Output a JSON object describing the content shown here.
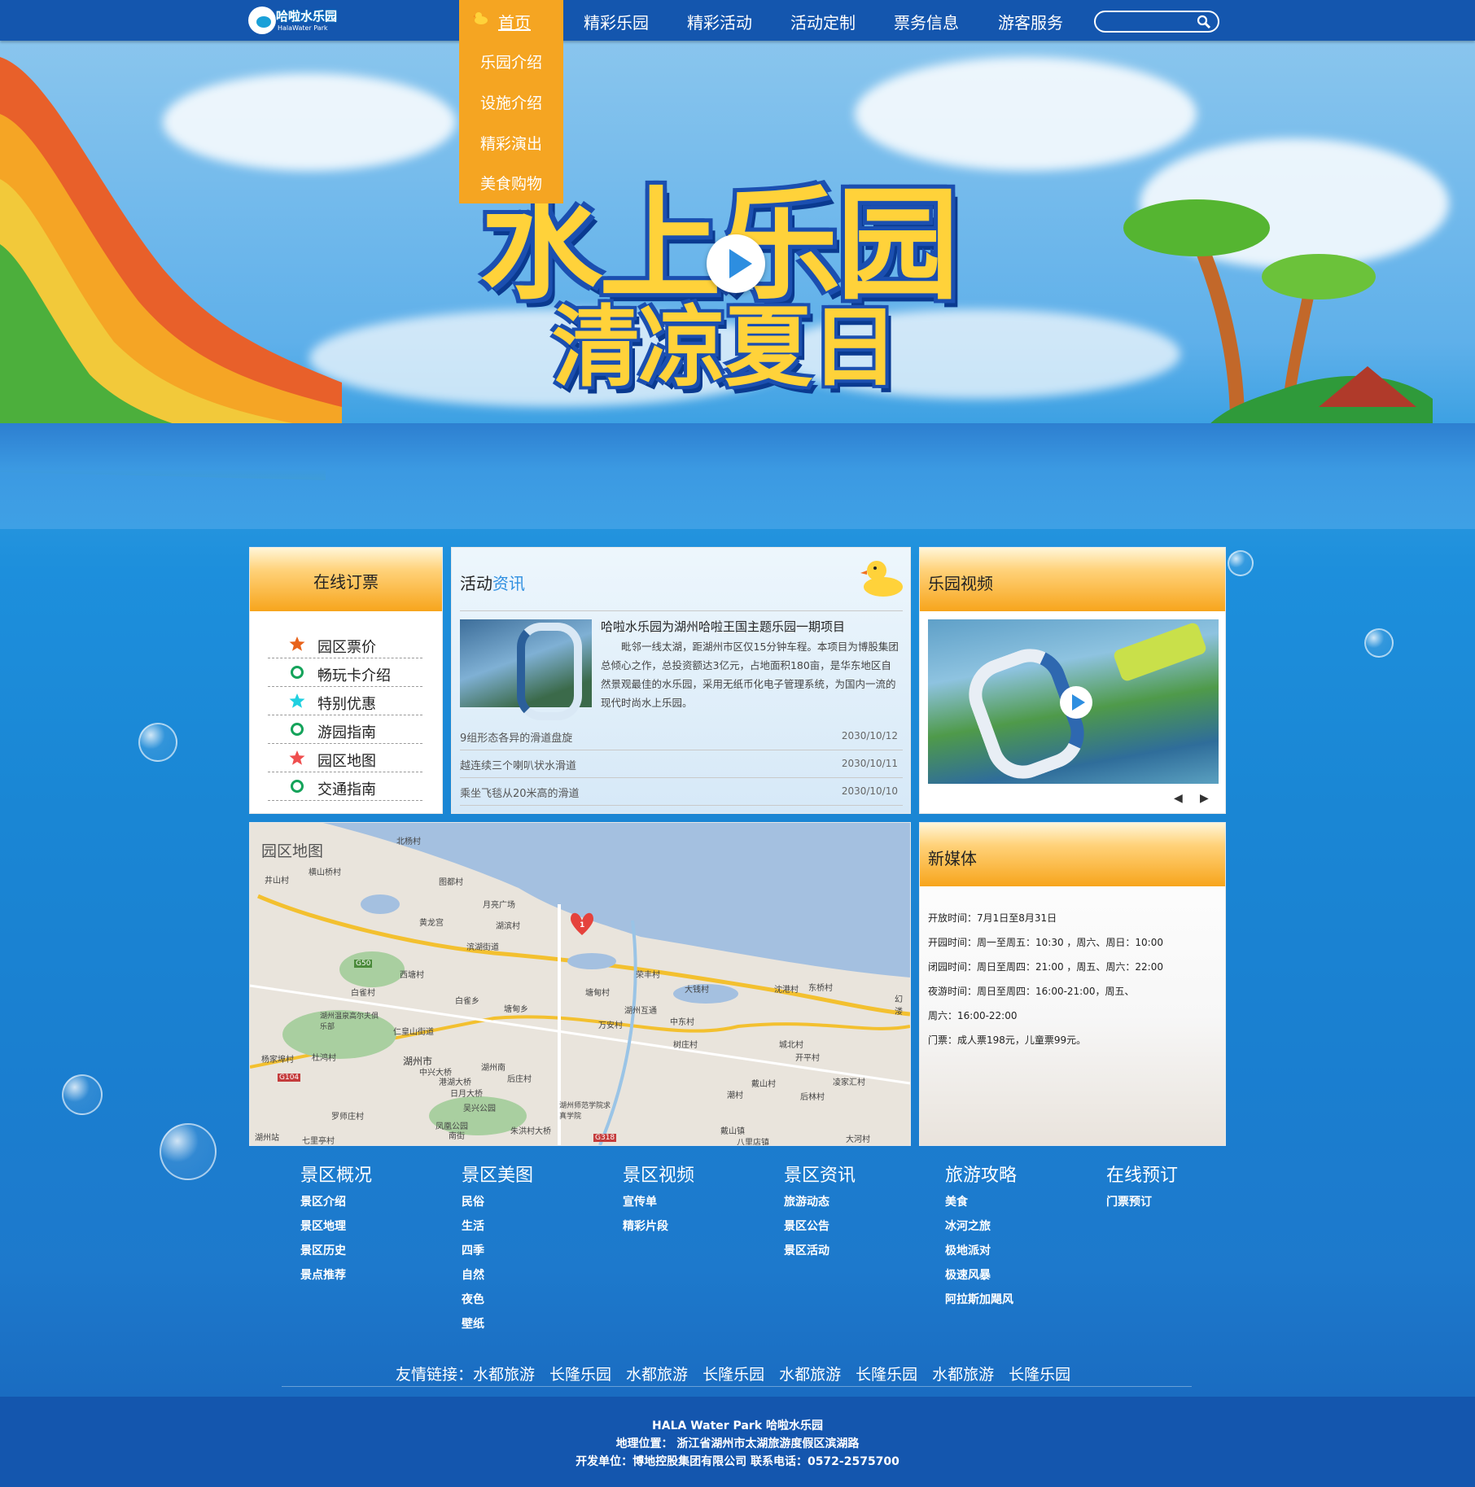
{
  "logo": {
    "name": "哈啦水乐园",
    "sub": "HalaWater Park"
  },
  "nav": {
    "home": "首页",
    "items": [
      "精彩乐园",
      "精彩活动",
      "活动定制",
      "票务信息",
      "游客服务"
    ],
    "dropdown": [
      "乐园介绍",
      "设施介绍",
      "精彩演出",
      "美食购物"
    ],
    "search_placeholder": ""
  },
  "hero": {
    "title_line1": "水上乐园",
    "title_line2": "清凉夏日"
  },
  "booking": {
    "title": "在线订票",
    "items": [
      {
        "label": "园区票价",
        "icon": "star-icon",
        "color": "#e8621a"
      },
      {
        "label": "畅玩卡介绍",
        "icon": "ring-icon",
        "color": "#14a35a"
      },
      {
        "label": "特别优惠",
        "icon": "star-icon",
        "color": "#1fd0e0"
      },
      {
        "label": "游园指南",
        "icon": "ring-icon",
        "color": "#14a35a"
      },
      {
        "label": "园区地图",
        "icon": "star-icon",
        "color": "#ef4e4e"
      },
      {
        "label": "交通指南",
        "icon": "ring-icon",
        "color": "#14a35a"
      }
    ]
  },
  "news": {
    "title_a": "活动",
    "title_b": "资讯",
    "headline": "哈啦水乐园为湖州哈啦王国主题乐园一期项目",
    "body": "毗邻一线太湖，距湖州市区仅15分钟车程。本项目为博股集团总倾心之作，总投资额达3亿元，占地面积180亩，是华东地区自然景观最佳的水乐园，采用无纸币化电子管理系统，为国内一流的现代时尚水上乐园。",
    "rows": [
      {
        "text": "9组形态各异的滑道盘旋",
        "date": "2030/10/12"
      },
      {
        "text": "越连续三个喇叭状水滑道",
        "date": "2030/10/11"
      },
      {
        "text": "乘坐飞毯从20米高的滑道",
        "date": "2030/10/10"
      }
    ]
  },
  "video": {
    "title": "乐园视频",
    "prev": "◀",
    "next": "▶"
  },
  "map": {
    "title": "园区地图",
    "labels": [
      "北杨村",
      "横山桥村",
      "井山村",
      "图都村",
      "月亮广场",
      "黄龙宫",
      "湖滨村",
      "滨湖街道",
      "西塘村",
      "白雀村",
      "白雀乡",
      "塘甸乡",
      "塘甸村",
      "荣丰村",
      "大钱村",
      "沈港村",
      "东桥村",
      "湖州温泉高尔夫俱乐部",
      "仁皇山街道",
      "万安村",
      "湖州互通",
      "中东村",
      "杨家埠村",
      "杜鸿村",
      "湖州市",
      "中兴大桥",
      "湖州南",
      "树庄村",
      "城北村",
      "港湖大桥",
      "日月大桥",
      "后庄村",
      "开平村",
      "戴山村",
      "湖州师范学院求真学院",
      "潮村",
      "后林村",
      "凌家汇村",
      "罗师庄村",
      "吴兴公园",
      "凤凰公园",
      "南街",
      "朱洪村大桥",
      "戴山镇",
      "八里店镇",
      "大河村",
      "七里亭村",
      "湖州站",
      "幻溇",
      "G50",
      "G104",
      "G318",
      "1"
    ]
  },
  "media": {
    "title": "新媒体",
    "lines": [
      "开放时间：7月1日至8月31日",
      "开园时间：周一至周五：10:30 ，周六、周日：10:00",
      "闭园时间：周日至周四：21:00 ，周五、周六：22:00",
      "夜游时间：周日至周四：16:00-21:00，周五、",
      "周六：16:00-22:00",
      "门票：成人票198元，儿童票99元。"
    ]
  },
  "footer_cols": [
    {
      "title": "景区概况",
      "links": [
        "景区介绍",
        "景区地理",
        "景区历史",
        "景点推荐"
      ]
    },
    {
      "title": "景区美图",
      "links": [
        "民俗",
        "生活",
        "四季",
        "自然",
        "夜色",
        "壁纸"
      ]
    },
    {
      "title": "景区视频",
      "links": [
        "宣传单",
        "精彩片段"
      ]
    },
    {
      "title": "景区资讯",
      "links": [
        "旅游动态",
        "景区公告",
        "景区活动"
      ]
    },
    {
      "title": "旅游攻略",
      "links": [
        "美食",
        "冰河之旅",
        "极地派对",
        "极速风暴",
        "阿拉斯加飓风"
      ]
    },
    {
      "title": "在线预订",
      "links": [
        "门票预订"
      ]
    }
  ],
  "friends": {
    "label": "友情链接：",
    "links": [
      "水都旅游",
      "长隆乐园",
      "水都旅游",
      "长隆乐园",
      "水都旅游",
      "长隆乐园",
      "水都旅游",
      "长隆乐园"
    ]
  },
  "footer": {
    "line1": "HALA Water Park    哈啦水乐园",
    "line2": "地理位置： 浙江省湖州市太湖旅游度假区滨湖路",
    "line3": "开发单位：博地控股集团有限公司   联系电话：0572-2575700"
  },
  "colors": {
    "nav": "#1456ae",
    "accent": "#f5a522",
    "news_link": "#2f8fe0"
  }
}
